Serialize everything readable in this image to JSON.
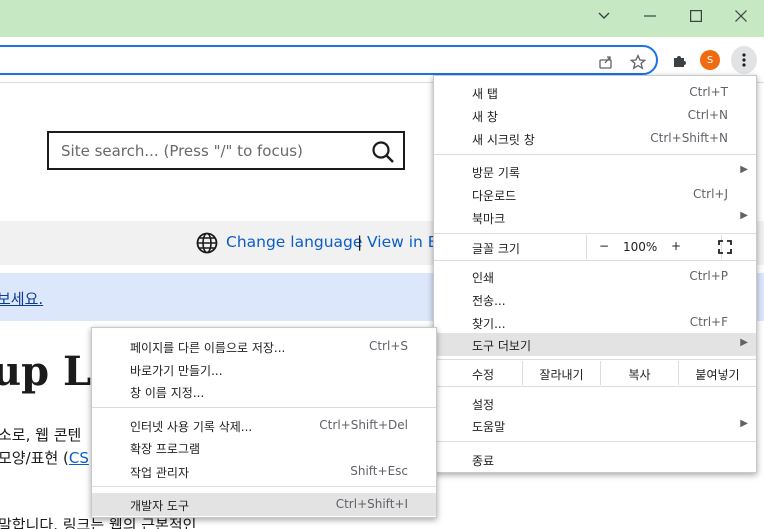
{
  "browser": {
    "profile_initial": "S",
    "accent_color": "#c6e8c3",
    "icons": [
      "chevron-down-icon",
      "minimize-icon",
      "maximize-icon",
      "close-icon",
      "share-icon",
      "star-icon",
      "extensions-icon",
      "kebab-menu-icon"
    ]
  },
  "page": {
    "search_placeholder": "Site search... (Press \"/\" to focus)",
    "change_language": "Change language",
    "separator": "|",
    "view_in": "View in E",
    "notice": "보세요.",
    "heading": "up L",
    "line1": "소로, 웹 콘텐",
    "line2_prefix": "모양/표현 (",
    "line2_link": "CS",
    "line3": "말합니다. 링크는 웹의 근본적인"
  },
  "menu": {
    "new_tab": {
      "label": "새 탭",
      "shortcut": "Ctrl+T"
    },
    "new_window": {
      "label": "새 창",
      "shortcut": "Ctrl+N"
    },
    "new_incognito": {
      "label": "새 시크릿 창",
      "shortcut": "Ctrl+Shift+N"
    },
    "history": {
      "label": "방문 기록"
    },
    "downloads": {
      "label": "다운로드",
      "shortcut": "Ctrl+J"
    },
    "bookmarks": {
      "label": "북마크"
    },
    "zoom": {
      "label": "글꼴 크기",
      "minus": "−",
      "value": "100%",
      "plus": "+"
    },
    "print": {
      "label": "인쇄",
      "shortcut": "Ctrl+P"
    },
    "cast": {
      "label": "전송..."
    },
    "find": {
      "label": "찾기...",
      "shortcut": "Ctrl+F"
    },
    "more_tools": {
      "label": "도구 더보기"
    },
    "edit": {
      "label": "수정",
      "cut": "잘라내기",
      "copy": "복사",
      "paste": "붙여넣기"
    },
    "settings": {
      "label": "설정"
    },
    "help": {
      "label": "도움말"
    },
    "exit": {
      "label": "종료"
    },
    "arrow": "▶"
  },
  "submenu": {
    "save_page": {
      "label": "페이지를 다른 이름으로 저장...",
      "shortcut": "Ctrl+S"
    },
    "create_shortcut": {
      "label": "바로가기 만들기..."
    },
    "name_window": {
      "label": "창 이름 지정..."
    },
    "clear_data": {
      "label": "인터넷 사용 기록 삭제...",
      "shortcut": "Ctrl+Shift+Del"
    },
    "extensions": {
      "label": "확장 프로그램"
    },
    "task_manager": {
      "label": "작업 관리자",
      "shortcut": "Shift+Esc"
    },
    "dev_tools": {
      "label": "개발자 도구",
      "shortcut": "Ctrl+Shift+I"
    }
  }
}
